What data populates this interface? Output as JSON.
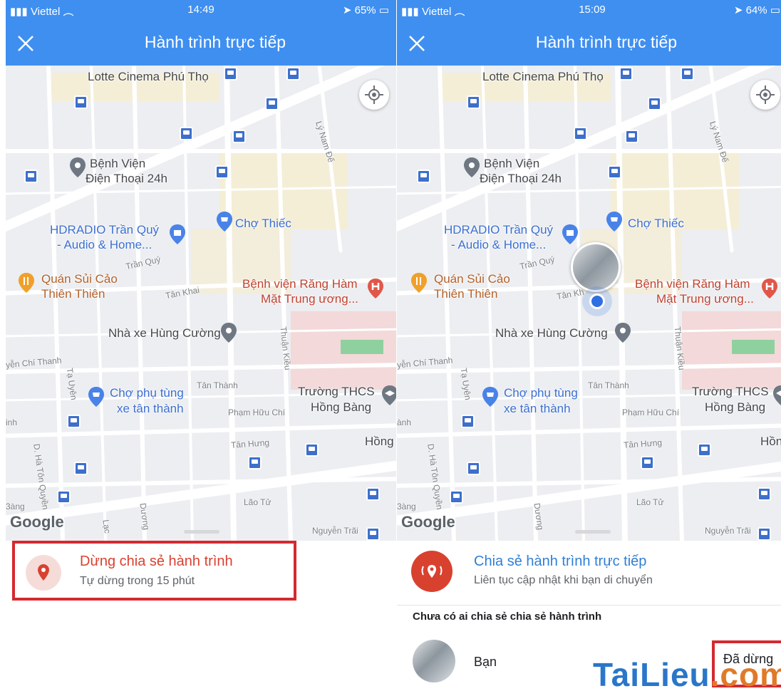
{
  "left_screen": {
    "status": {
      "carrier": "Viettel",
      "time": "14:49",
      "battery": "65%"
    },
    "header": {
      "title": "Hành trình trực tiếp",
      "close_icon": "close-icon"
    },
    "map": {
      "labels": {
        "lotte": "Lotte Cinema Phú Thọ",
        "benh_vien_1": "Bệnh Viện",
        "benh_vien_2": "Điện Thoại 24h",
        "cho_thiec": "Chợ Thiếc",
        "hdradio_1": "HDRADIO Trần Quý",
        "hdradio_2": "- Audio & Home...",
        "quan_sui_1": "Quán Sủi Cảo",
        "quan_sui_2": "Thiên Thiên",
        "rang_ham_1": "Bệnh viện Răng Hàm",
        "rang_ham_2": "Mặt Trung ương...",
        "nha_xe": "Nhà xe Hùng Cường",
        "cho_phu_tung_1": "Chợ phụ tùng",
        "cho_phu_tung_2": "xe tân thành",
        "truong_1": "Trường THCS",
        "truong_2": "Hồng Bàng",
        "hong": "Hồng",
        "street_tran_quy": "Trần Quý",
        "street_tan_khai": "Tân Khai",
        "street_ly_nam_de": "Lý Nam Đế",
        "street_chi_thanh": "yễn Chí Thanh",
        "street_ta_uyen": "Tạ Uyên",
        "street_tan_thanh": "Tân Thành",
        "street_pham_huu_chi": "Phạm Hữu Chí",
        "street_tan_hung": "Tân Hưng",
        "street_thuan_kieu": "Thuận Kiều",
        "street_ha_ton_quyen": "D. Hà Tôn Quyền",
        "street_lao_tu": "Lão Tử",
        "street_nguyen_trai": "Nguyễn Trãi",
        "street_duong": "Dương",
        "street_lac": "Lạc",
        "street_bang": "3àng",
        "street_inh": "inh",
        "google": "Google"
      }
    },
    "sheet": {
      "title": "Dừng chia sẻ hành trình",
      "subtitle": "Tự dừng trong 15 phút"
    }
  },
  "right_screen": {
    "status": {
      "carrier": "Viettel",
      "time": "15:09",
      "battery": "64%"
    },
    "header": {
      "title": "Hành trình trực tiếp",
      "close_icon": "close-icon"
    },
    "map": {
      "labels": {
        "lotte": "Lotte Cinema Phú Thọ",
        "benh_vien_1": "Bệnh Viện",
        "benh_vien_2": "Điện Thoại 24h",
        "cho_thiec": "Chợ Thiếc",
        "hdradio_1": "HDRADIO Trần Quý",
        "hdradio_2": "- Audio & Home...",
        "quan_sui_1": "Quán Sủi Cảo",
        "quan_sui_2": "Thiên Thiên",
        "rang_ham_1": "Bệnh viện Răng Hàm",
        "rang_ham_2": "Mặt Trung ương...",
        "nha_xe": "Nhà xe Hùng Cường",
        "cho_phu_tung_1": "Chợ phụ tùng",
        "cho_phu_tung_2": "xe tân thành",
        "truong_1": "Trường THCS",
        "truong_2": "Hồng Bàng",
        "hong": "Hồn",
        "street_tran_quy": "Trần Quý",
        "street_tan_khai": "Tân Kh",
        "street_ly_nam_de": "Lý Nam Đế",
        "street_chi_thanh": "yễn Chí Thanh",
        "street_ta_uyen": "Tạ Uyên",
        "street_tan_thanh": "Tân Thành",
        "street_pham_huu_chi": "Phạm Hữu Chí",
        "street_tan_hung": "Tân Hưng",
        "street_thuan_kieu": "Thuận Kiều",
        "street_ha_ton_quyen": "D. Hà Tôn Quyền",
        "street_lao_tu": "Lão Tử",
        "street_nguyen_trai": "Nguyễn Trãi",
        "street_duong": "Dương",
        "street_bang": "3àng",
        "street_anh": "ành",
        "google": "Google"
      }
    },
    "sheet": {
      "title": "Chia sẻ hành trình trực tiếp",
      "subtitle": "Liên tục cập nhật khi bạn di chuyển",
      "section_header": "Chưa có ai chia sẻ chia sẻ hành trình",
      "user_name": "Bạn",
      "status": "Đã dừng"
    }
  },
  "watermark": {
    "part1": "Tai",
    "part2": "Lieu",
    "part3": ".com"
  },
  "colors": {
    "app_bar": "#3f8ff0",
    "highlight": "#d42a30",
    "share_icon": "#d9412f"
  }
}
